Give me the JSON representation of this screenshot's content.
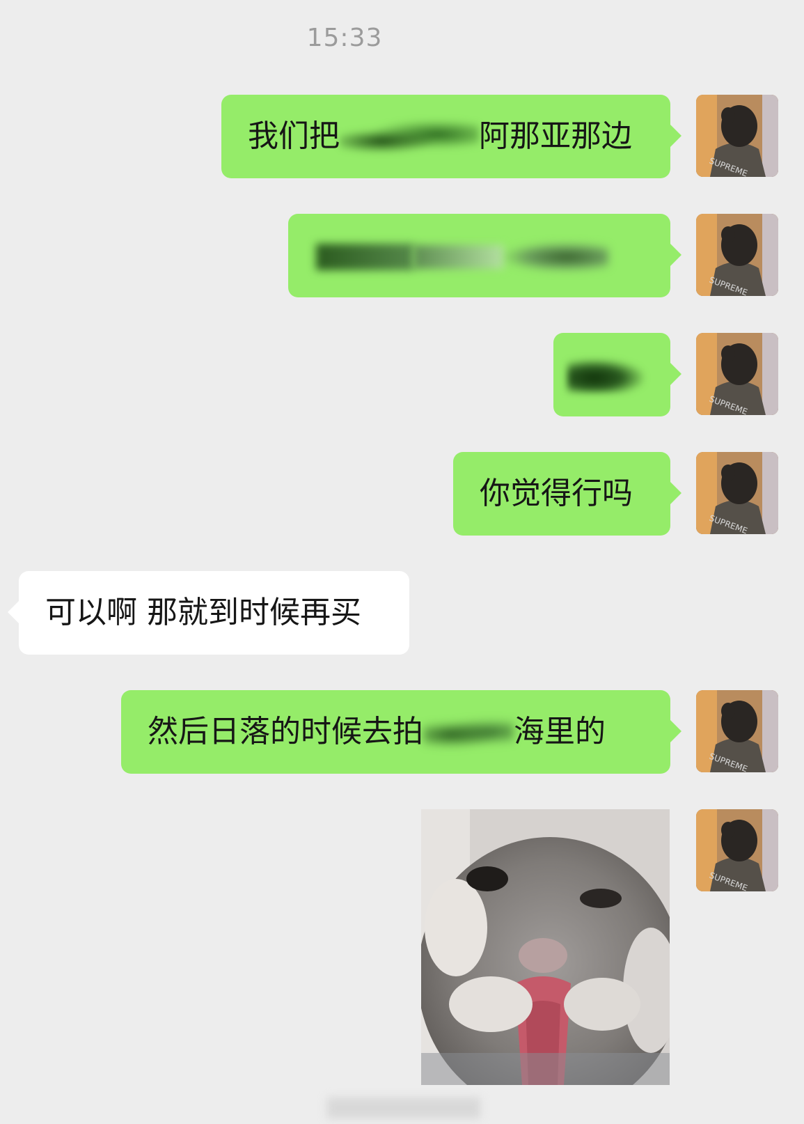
{
  "timestamp": "15:33",
  "messages": [
    {
      "side": "out",
      "parts": [
        "我们把",
        "",
        "阿那亚那边"
      ]
    },
    {
      "side": "out",
      "parts": [
        "",
        "",
        ""
      ]
    },
    {
      "side": "out",
      "parts": [
        ""
      ]
    },
    {
      "side": "out",
      "parts": [
        "你觉得行吗"
      ]
    },
    {
      "side": "in",
      "parts": [
        "可以啊 那就到时候再买"
      ]
    },
    {
      "side": "out",
      "parts": [
        "然后日落的时候去拍",
        "",
        "海里的"
      ]
    }
  ],
  "avatar_icon": "person-avatar-icon",
  "sticker": "cat-sticker-image",
  "colors": {
    "background": "#ededed",
    "outgoing_bubble": "#95ec69",
    "incoming_bubble": "#ffffff",
    "timestamp": "#9b9b9b"
  }
}
